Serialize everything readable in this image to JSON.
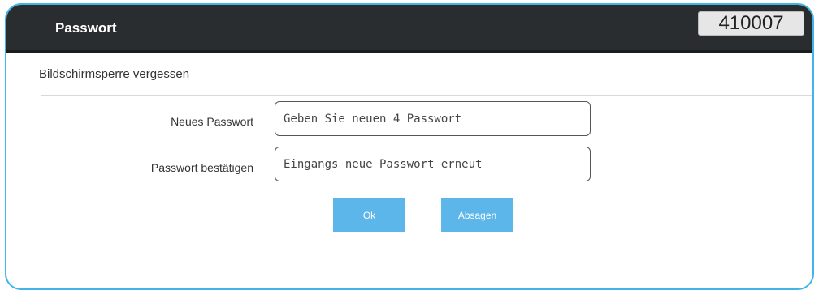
{
  "header": {
    "title": "Passwort",
    "code": "410007"
  },
  "dialog": {
    "subtitle": "Bildschirmsperre vergessen",
    "fields": [
      {
        "label": "Neues Passwort",
        "placeholder": "Geben Sie neuen 4 Passwort"
      },
      {
        "label": "Passwort bestätigen",
        "placeholder": "Eingangs neue Passwort erneut"
      }
    ],
    "buttons": {
      "ok": "Ok",
      "cancel": "Absagen"
    }
  },
  "colors": {
    "header_bg": "#2a2d30",
    "frame_border": "#41b4e8",
    "button_bg": "#5cb6ea"
  }
}
